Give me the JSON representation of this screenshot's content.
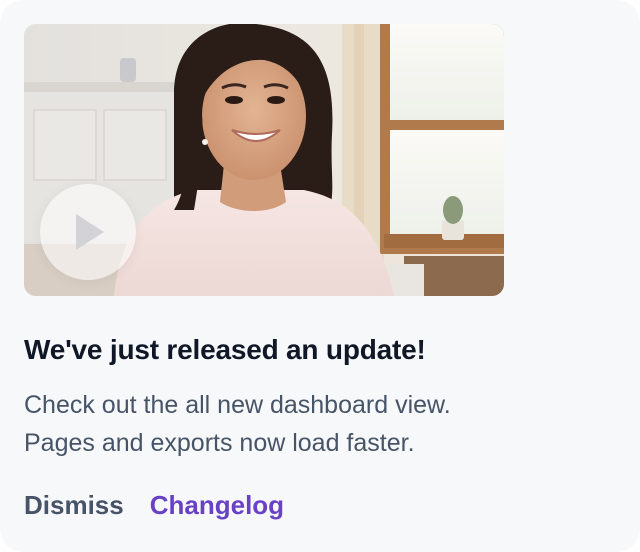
{
  "notification": {
    "title": "We've just released an update!",
    "description_line1": "Check out the all new dashboard view.",
    "description_line2": "Pages and exports now load faster.",
    "dismiss_label": "Dismiss",
    "changelog_label": "Changelog"
  },
  "video": {
    "play_icon": "play-icon"
  },
  "colors": {
    "title": "#101828",
    "body": "#475467",
    "accent": "#6941c6",
    "card_bg": "#f7f8fa"
  }
}
